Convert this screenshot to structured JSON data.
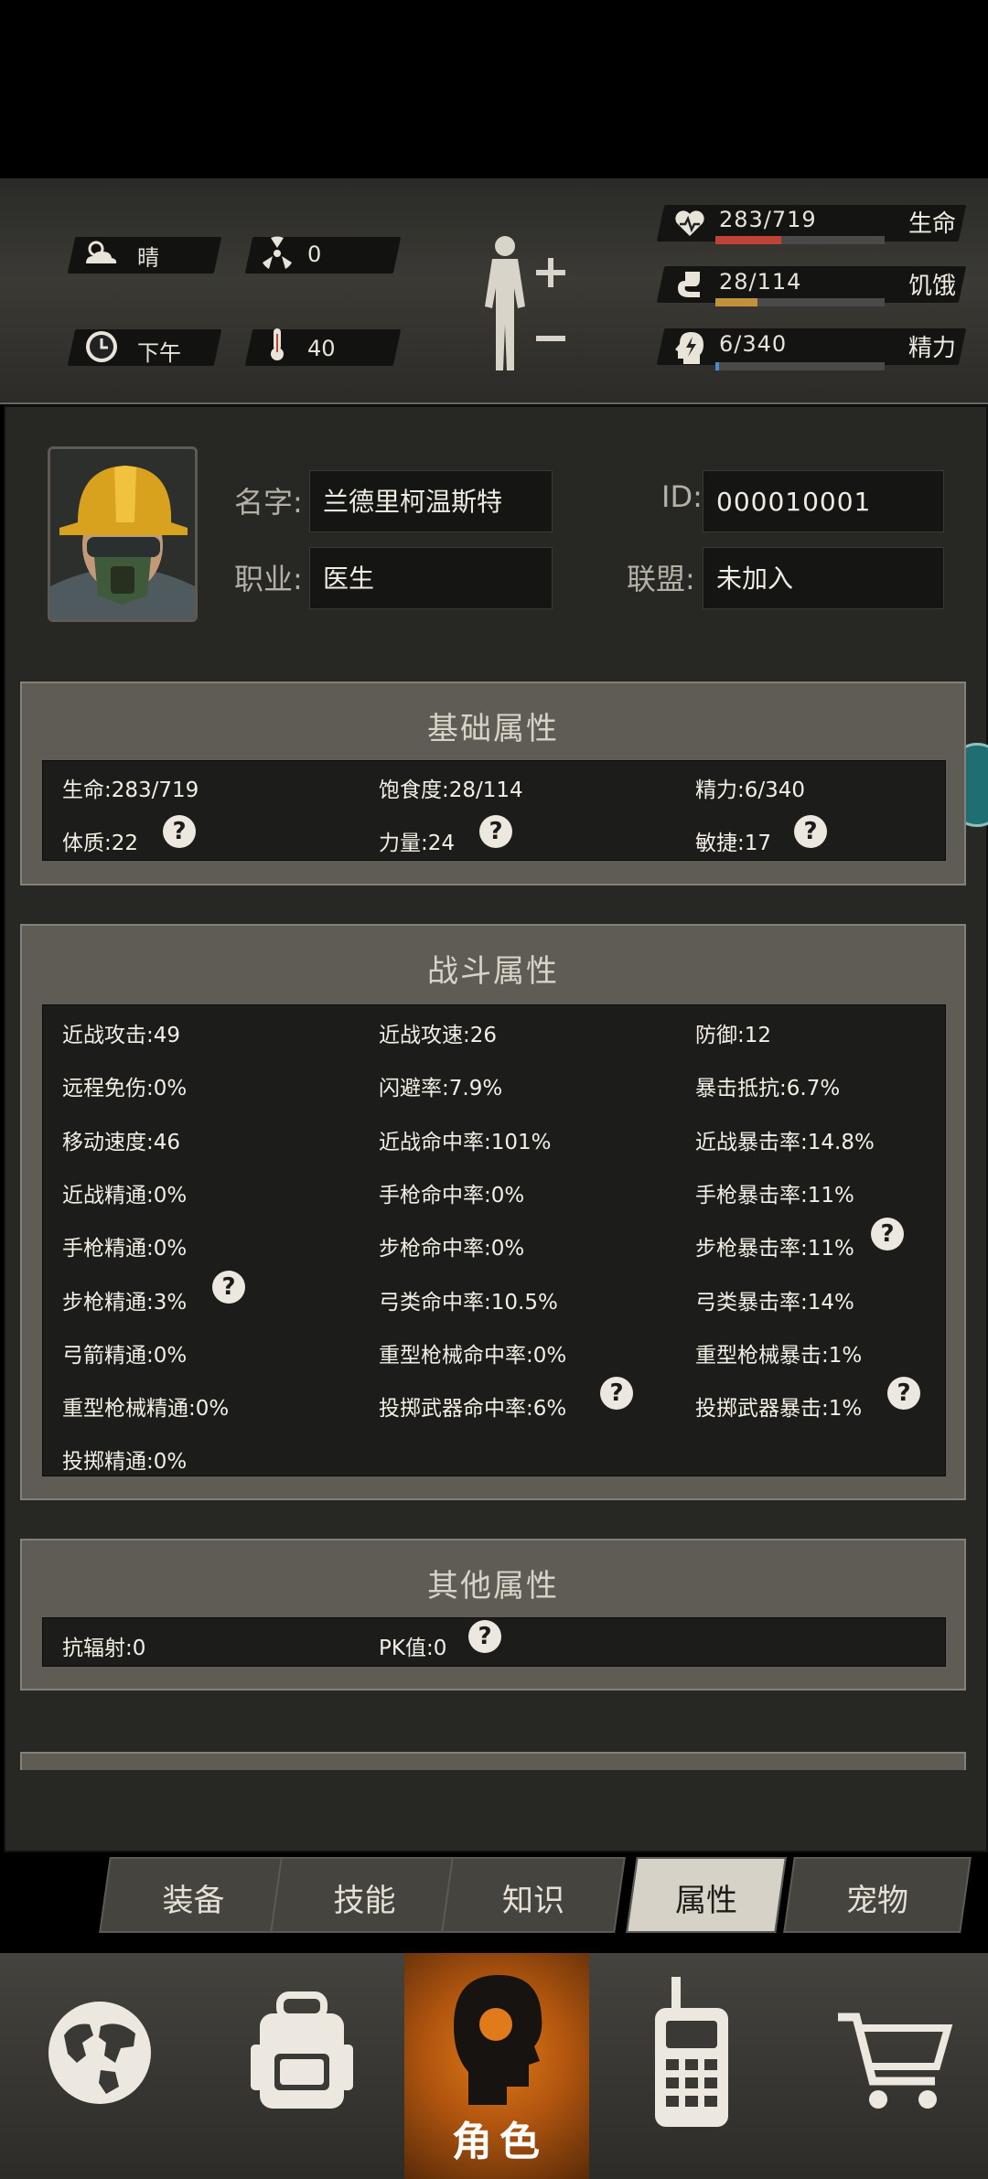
{
  "status": {
    "weather": "晴",
    "radiation": "0",
    "time": "下午",
    "temperature": "40",
    "life": {
      "value": "283/719",
      "label": "生命",
      "fraction": 0.39,
      "color": "#c0433a"
    },
    "hunger": {
      "value": "28/114",
      "label": "饥饿",
      "fraction": 0.25,
      "color": "#c2923a"
    },
    "energy": {
      "value": "6/340",
      "label": "精力",
      "fraction": 0.02,
      "color": "#4a8ad0"
    }
  },
  "profile": {
    "name_label": "名字:",
    "name": "兰德里柯温斯特",
    "id_label": "ID:",
    "id": "000010001",
    "job_label": "职业:",
    "job": "医生",
    "alliance_label": "联盟:",
    "alliance": "未加入"
  },
  "basic": {
    "title": "基础属性",
    "life": "生命:283/719",
    "satiety": "饱食度:28/114",
    "energy": "精力:6/340",
    "constitution": "体质:22",
    "strength": "力量:24",
    "agility": "敏捷:17"
  },
  "combat": {
    "title": "战斗属性",
    "rows": [
      [
        "近战攻击:49",
        "近战攻速:26",
        "防御:12"
      ],
      [
        "远程免伤:0%",
        "闪避率:7.9%",
        "暴击抵抗:6.7%"
      ],
      [
        "移动速度:46",
        "近战命中率:101%",
        "近战暴击率:14.8%"
      ],
      [
        "近战精通:0%",
        "手枪命中率:0%",
        "手枪暴击率:11%"
      ],
      [
        "手枪精通:0%",
        "步枪命中率:0%",
        "步枪暴击率:11%"
      ],
      [
        "步枪精通:3%",
        "弓类命中率:10.5%",
        "弓类暴击率:14%"
      ],
      [
        "弓箭精通:0%",
        "重型枪械命中率:0%",
        "重型枪械暴击:1%"
      ],
      [
        "重型枪械精通:0%",
        "投掷武器命中率:6%",
        "投掷武器暴击:1%"
      ],
      [
        "投掷精通:0%",
        "",
        ""
      ]
    ]
  },
  "other": {
    "title": "其他属性",
    "radiation_resist": "抗辐射:0",
    "pk": "PK值:0"
  },
  "tabs": [
    "装备",
    "技能",
    "知识",
    "属性",
    "宠物"
  ],
  "nav": {
    "role_label": "角色"
  },
  "help_glyph": "?"
}
